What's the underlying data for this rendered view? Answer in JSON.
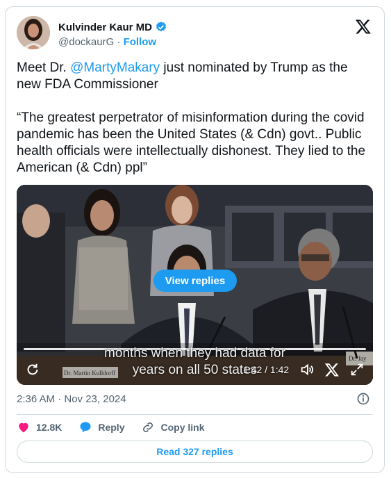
{
  "author": {
    "name": "Kulvinder Kaur MD",
    "handle": "@dockaurG",
    "separator": " · ",
    "follow_label": "Follow"
  },
  "tweet": {
    "line1_prefix": "Meet Dr. ",
    "mention": "@MartyMakary",
    "line1_suffix": " just nominated by Trump as the new FDA Commissioner",
    "quote": "“The greatest perpetrator of misinformation during the covid pandemic has been the United States (& Cdn) govt.. Public health officials were intellectually dishonest. They lied to the American (& Cdn) ppl”"
  },
  "video": {
    "view_replies_label": "View replies",
    "caption_line1": "months when they had data for",
    "caption_line2": "years on all 50 states",
    "time": "1:42 / 1:42",
    "progress": 1.0,
    "nameplate_left": "Dr. Martin Kulldorff",
    "nameplate_right": "Dr. Jay"
  },
  "meta": {
    "timestamp": "2:36 AM · Nov 23, 2024"
  },
  "actions": {
    "likes": "12.8K",
    "reply_label": "Reply",
    "copy_link_label": "Copy link"
  },
  "read_replies_label": "Read 327 replies",
  "colors": {
    "accent": "#1d9bf0",
    "like": "#f91880",
    "text": "#0f1419",
    "secondary": "#536471"
  },
  "icons": {
    "verified": "verified-badge-icon",
    "x_logo": "x-logo-icon",
    "info": "info-icon",
    "like": "heart-icon",
    "reply": "speech-bubble-icon",
    "copy_link": "link-icon",
    "replay": "replay-icon",
    "volume": "volume-icon",
    "expand": "expand-icon"
  }
}
